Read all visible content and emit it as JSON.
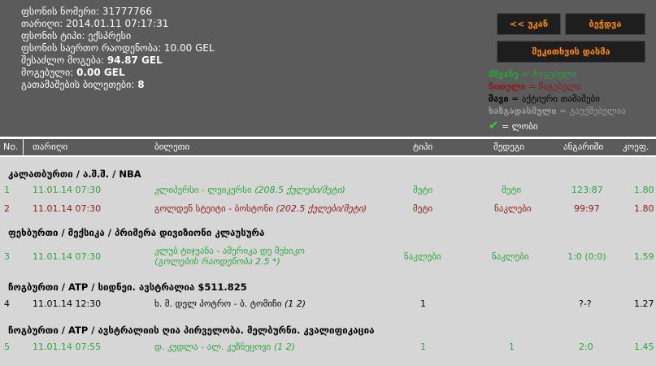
{
  "ticket": {
    "number_label": "ფსონის ნომერი:",
    "number": "31777766",
    "date_label": "თარიღი:",
    "date": "2014.01.11 07:17:31",
    "type_label": "ფსონის ტიპი:",
    "type": "ექსპრესი",
    "amount_label": "ფსონის საერთო რაოდენობა:",
    "amount": "10.00 GEL",
    "possible_label": "შესაძლო მოგება:",
    "possible": "94.87 GEL",
    "won_label": "მოგებული:",
    "won": "0.00 GEL",
    "count_label": "გათამაშების ბილეთები:",
    "count": "8"
  },
  "buttons": {
    "back": "<< უკან",
    "print": "ბეჭდვა",
    "print_stake": "შეკითხვის დასმა"
  },
  "legend": [
    {
      "word": "მწვანე",
      "desc": "= მოგებული",
      "color": "#2aa53a"
    },
    {
      "word": "წითელი",
      "desc": "= წაგებული",
      "color": "#8e1a1a"
    },
    {
      "word": "შავი",
      "desc": "= აქტიური თამაშები",
      "color": "#000000"
    },
    {
      "word": "ხაზგადასმული",
      "desc": "= გაუქმებულია",
      "color": "#8a8a8a"
    },
    {
      "word": "✔",
      "desc": "= ლობი",
      "color": "#33d033"
    }
  ],
  "columns": {
    "no": "No.",
    "date": "თარიღი",
    "ticket": "ბილეთი",
    "type": "ტიპი",
    "result": "შედეგი",
    "score": "ანგარიში",
    "coef": "კოეფ."
  },
  "groups": [
    {
      "title": "კალათბურთი / ა.შ.შ. / NBA"
    },
    {
      "title": "ფეხბურთი / მექსიკა / პრიმერა დივიზიონი კლაუსურა"
    },
    {
      "title": "ჩოგბურთი / ATP / სიდნეი. ავსტრალია $511.825"
    },
    {
      "title": "ჩოგბურთი / ATP / ავსტრალიის ღია პირველობა. მელბურნი. კვალიფიკაცია"
    }
  ],
  "rows": [
    {
      "no": "1",
      "date": "11.01.14 07:30",
      "match": "კლიპერსი - ლეიკერსი",
      "detail": "(208.5 ქულები/მეტი)",
      "type": "მეტი",
      "result": "მეტი",
      "score": "123:87",
      "coef": "1.80",
      "status": "green"
    },
    {
      "no": "2",
      "date": "11.01.14 07:30",
      "match": "გოლდენ სტეიტი - ბოსტონი",
      "detail": "(202.5 ქულები/მეტი)",
      "type": "მეტი",
      "result": "ნაკლები",
      "score": "99:97",
      "coef": "1.80",
      "status": "red"
    },
    {
      "no": "3",
      "date": "11.01.14 07:30",
      "match": "კლუბ ტიჯუანა - ამერიკა დე მეხიკო",
      "detail": "(გოლების რაოდენობა 2.5 *)",
      "type": "ნაკლები",
      "result": "ნაკლები",
      "score": "1:0 (0:0)",
      "coef": "1.59",
      "status": "green"
    },
    {
      "no": "4",
      "date": "11.01.14 12:30",
      "match": "ხ. მ. დელ პოტრო - ბ. ტომიჩი",
      "detail": "(1 2)",
      "type": "1",
      "result": "",
      "score": "?-?",
      "coef": "1.27",
      "status": "black"
    },
    {
      "no": "5",
      "date": "11.01.14 07:55",
      "match": "დ. კუდლა - ალ. კუზნეცოვი",
      "detail": "(1 2)",
      "type": "1",
      "result": "1",
      "score": "2:0",
      "coef": "1.45",
      "status": "green"
    }
  ]
}
